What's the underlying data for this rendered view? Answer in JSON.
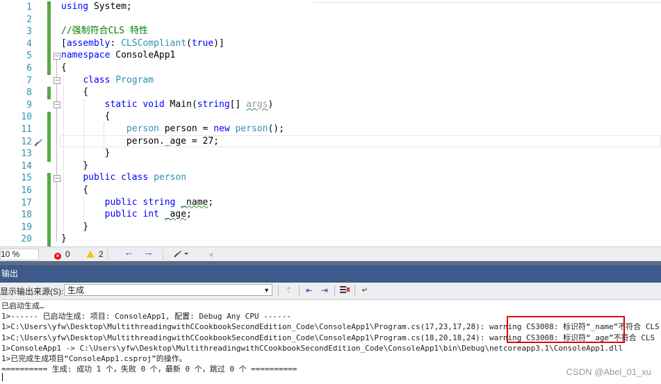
{
  "editor": {
    "line_numbers": [
      "1",
      "2",
      "3",
      "4",
      "5",
      "6",
      "7",
      "8",
      "9",
      "10",
      "11",
      "12",
      "13",
      "14",
      "15",
      "16",
      "17",
      "18",
      "19",
      "20"
    ],
    "lines": [
      {
        "num": "1",
        "parts": [
          {
            "t": "using",
            "c": "kw"
          },
          {
            "t": " System;",
            "c": ""
          }
        ]
      },
      {
        "num": "2",
        "parts": []
      },
      {
        "num": "3",
        "parts": [
          {
            "t": "//强制符合CLS 特性",
            "c": "cm"
          }
        ]
      },
      {
        "num": "4",
        "parts": [
          {
            "t": "[",
            "c": ""
          },
          {
            "t": "assembly",
            "c": "kw"
          },
          {
            "t": ": ",
            "c": ""
          },
          {
            "t": "CLSCompliant",
            "c": "ty"
          },
          {
            "t": "(",
            "c": ""
          },
          {
            "t": "true",
            "c": "kw"
          },
          {
            "t": ")]",
            "c": ""
          }
        ]
      },
      {
        "num": "5",
        "parts": [
          {
            "t": "namespace",
            "c": "kw"
          },
          {
            "t": " ConsoleApp1",
            "c": ""
          }
        ]
      },
      {
        "num": "6",
        "parts": [
          {
            "t": "{",
            "c": ""
          }
        ]
      },
      {
        "num": "7",
        "parts": [
          {
            "t": "    ",
            "c": ""
          },
          {
            "t": "class",
            "c": "kw"
          },
          {
            "t": " ",
            "c": ""
          },
          {
            "t": "Program",
            "c": "ty"
          }
        ]
      },
      {
        "num": "8",
        "parts": [
          {
            "t": "    {",
            "c": ""
          }
        ]
      },
      {
        "num": "9",
        "parts": [
          {
            "t": "        ",
            "c": ""
          },
          {
            "t": "static",
            "c": "kw"
          },
          {
            "t": " ",
            "c": ""
          },
          {
            "t": "void",
            "c": "kw"
          },
          {
            "t": " Main(",
            "c": ""
          },
          {
            "t": "string",
            "c": "kw"
          },
          {
            "t": "[] ",
            "c": ""
          },
          {
            "t": "args",
            "c": "gr sq"
          },
          {
            "t": ")",
            "c": ""
          }
        ]
      },
      {
        "num": "10",
        "parts": [
          {
            "t": "        {",
            "c": ""
          }
        ]
      },
      {
        "num": "11",
        "parts": [
          {
            "t": "            ",
            "c": ""
          },
          {
            "t": "person",
            "c": "ty"
          },
          {
            "t": " person = ",
            "c": ""
          },
          {
            "t": "new",
            "c": "kw"
          },
          {
            "t": " ",
            "c": ""
          },
          {
            "t": "person",
            "c": "ty"
          },
          {
            "t": "();",
            "c": ""
          }
        ]
      },
      {
        "num": "12",
        "parts": [
          {
            "t": "            person._age = 27;",
            "c": ""
          }
        ]
      },
      {
        "num": "13",
        "parts": [
          {
            "t": "        }",
            "c": ""
          }
        ]
      },
      {
        "num": "14",
        "parts": [
          {
            "t": "    }",
            "c": ""
          }
        ]
      },
      {
        "num": "15",
        "parts": [
          {
            "t": "    ",
            "c": ""
          },
          {
            "t": "public",
            "c": "kw"
          },
          {
            "t": " ",
            "c": ""
          },
          {
            "t": "class",
            "c": "kw"
          },
          {
            "t": " ",
            "c": ""
          },
          {
            "t": "person",
            "c": "ty"
          }
        ]
      },
      {
        "num": "16",
        "parts": [
          {
            "t": "    {",
            "c": ""
          }
        ]
      },
      {
        "num": "17",
        "parts": [
          {
            "t": "        ",
            "c": ""
          },
          {
            "t": "public",
            "c": "kw"
          },
          {
            "t": " ",
            "c": ""
          },
          {
            "t": "string",
            "c": "kw"
          },
          {
            "t": " ",
            "c": ""
          },
          {
            "t": "_name",
            "c": "sq"
          },
          {
            "t": ";",
            "c": ""
          }
        ]
      },
      {
        "num": "18",
        "parts": [
          {
            "t": "        ",
            "c": ""
          },
          {
            "t": "public",
            "c": "kw"
          },
          {
            "t": " ",
            "c": ""
          },
          {
            "t": "int",
            "c": "kw"
          },
          {
            "t": " ",
            "c": ""
          },
          {
            "t": "_age",
            "c": "sq"
          },
          {
            "t": ";",
            "c": ""
          }
        ]
      },
      {
        "num": "19",
        "parts": [
          {
            "t": "    }",
            "c": ""
          }
        ]
      },
      {
        "num": "20",
        "parts": [
          {
            "t": "}",
            "c": ""
          }
        ]
      }
    ]
  },
  "status_bar": {
    "zoom": "10 %",
    "errors": "0",
    "warnings": "2"
  },
  "output": {
    "title": "输出",
    "source_label": "显示输出来源(S):",
    "source_value": "生成",
    "lines": [
      "已启动生成…",
      "1>------ 已启动生成: 项目: ConsoleApp1, 配置: Debug Any CPU ------",
      "1>C:\\Users\\yfw\\Desktop\\MultithreadingwithCCookbookSecondEdition_Code\\ConsoleApp1\\Program.cs(17,23,17,28): warning CS3008: 标识符“_name”不符合 CLS",
      "1>C:\\Users\\yfw\\Desktop\\MultithreadingwithCCookbookSecondEdition_Code\\ConsoleApp1\\Program.cs(18,20,18,24): warning CS3008: 标识符“_age”不符合 CLS",
      "1>ConsoleApp1 -> C:\\Users\\yfw\\Desktop\\MultithreadingwithCCookbookSecondEdition_Code\\ConsoleApp1\\bin\\Debug\\netcoreapp3.1\\ConsoleApp1.dll",
      "1>已完成生成项目“ConsoleApp1.csproj”的操作。",
      "========== 生成: 成功 1 个，失败 0 个，最新 0 个，跳过 0 个 =========="
    ]
  },
  "watermark": "CSDN @Abel_01_xu"
}
